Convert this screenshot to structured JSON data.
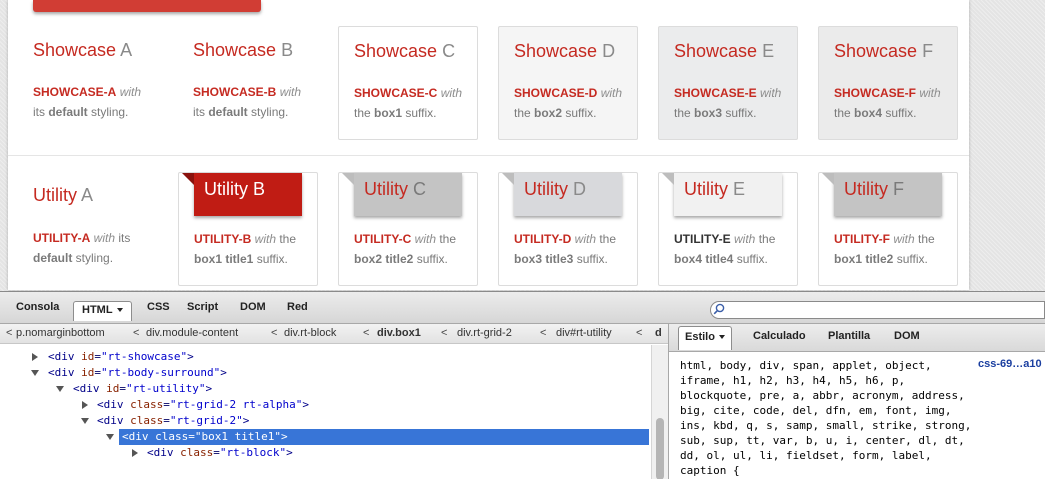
{
  "showcase": [
    {
      "title": "Showcase",
      "suffix": "A",
      "kw": "SHOWCASE-A",
      "with": "with",
      "line2a": "its ",
      "bold": "default",
      "line2b": " styling."
    },
    {
      "title": "Showcase",
      "suffix": "B",
      "kw": "SHOWCASE-B",
      "with": "with",
      "line2a": "its ",
      "bold": "default",
      "line2b": " styling."
    },
    {
      "title": "Showcase",
      "suffix": "C",
      "kw": "SHOWCASE-C",
      "with": "with",
      "line2a": "the ",
      "bold": "box1",
      "line2b": " suffix."
    },
    {
      "title": "Showcase",
      "suffix": "D",
      "kw": "SHOWCASE-D",
      "with": "with",
      "line2a": "the ",
      "bold": "box2",
      "line2b": " suffix."
    },
    {
      "title": "Showcase",
      "suffix": "E",
      "kw": "SHOWCASE-E",
      "with": "with",
      "line2a": "the ",
      "bold": "box3",
      "line2b": " suffix."
    },
    {
      "title": "Showcase",
      "suffix": "F",
      "kw": "SHOWCASE-F",
      "with": "with",
      "line2a": "the ",
      "bold": "box4",
      "line2b": " suffix."
    }
  ],
  "utility": [
    {
      "title": "Utility",
      "suffix": "A",
      "kw": "UTILITY-A",
      "with": "with",
      "after": " its",
      "bold": "default",
      "tail": " styling."
    },
    {
      "title": "Utility",
      "suffix": "B",
      "kw": "UTILITY-B",
      "with": "with",
      "after": " the",
      "bold": "box1 title1",
      "tail": " suffix."
    },
    {
      "title": "Utility",
      "suffix": "C",
      "kw": "UTILITY-C",
      "with": "with",
      "after": " the",
      "bold": "box2 title2",
      "tail": " suffix."
    },
    {
      "title": "Utility",
      "suffix": "D",
      "kw": "UTILITY-D",
      "with": "with",
      "after": " the",
      "bold": "box3 title3",
      "tail": " suffix."
    },
    {
      "title": "Utility",
      "suffix": "E",
      "kw": "UTILITY-E",
      "with": "with",
      "after": " the",
      "bold": "box4 title4",
      "tail": " suffix."
    },
    {
      "title": "Utility",
      "suffix": "F",
      "kw": "UTILITY-F",
      "with": "with",
      "after": " the",
      "bold": "box1 title2",
      "tail": " suffix."
    }
  ],
  "firebug": {
    "tabs": [
      "Consola",
      "HTML",
      "CSS",
      "Script",
      "DOM",
      "Red"
    ],
    "breadcrumbs": [
      "p.nomarginbottom",
      "div.module-content",
      "div.rt-block",
      "div.box1",
      "div.rt-grid-2",
      "div#rt-utility",
      "d"
    ],
    "tree": [
      {
        "open": false,
        "tag_open": "<div ",
        "attr": "id",
        "val": "\"rt-showcase\"",
        "tag_close": ">"
      },
      {
        "open": true,
        "tag_open": "<div ",
        "attr": "id",
        "val": "\"rt-body-surround\"",
        "tag_close": ">"
      },
      {
        "open": true,
        "tag_open": "<div ",
        "attr": "id",
        "val": "\"rt-utility\"",
        "tag_close": ">"
      },
      {
        "open": false,
        "tag_open": "<div ",
        "attr": "class",
        "val": "\"rt-grid-2 rt-alpha\"",
        "tag_close": ">"
      },
      {
        "open": true,
        "tag_open": "<div ",
        "attr": "class",
        "val": "\"rt-grid-2\"",
        "tag_close": ">"
      },
      {
        "open": true,
        "tag_open": "<div ",
        "attr": "class",
        "val": "\"box1 title1\"",
        "tag_close": ">"
      },
      {
        "open": false,
        "tag_open": "<div ",
        "attr": "class",
        "val": "\"rt-block\"",
        "tag_close": ">"
      }
    ],
    "right_tabs": [
      "Estilo",
      "Calculado",
      "Plantilla",
      "DOM"
    ],
    "css_rule": "html, body, div, span, applet, object,\niframe, h1, h2, h3, h4, h5, h6, p,\nblockquote, pre, a, abbr, acronym, address,\nbig, cite, code, del, dfn, em, font, img,\nins, kbd, q, s, samp, small, strike, strong,\nsub, sup, tt, var, b, u, i, center, dl, dt,\ndd, ol, ul, li, fieldset, form, label,\ncaption {",
    "css_source": "css-69…a10"
  }
}
